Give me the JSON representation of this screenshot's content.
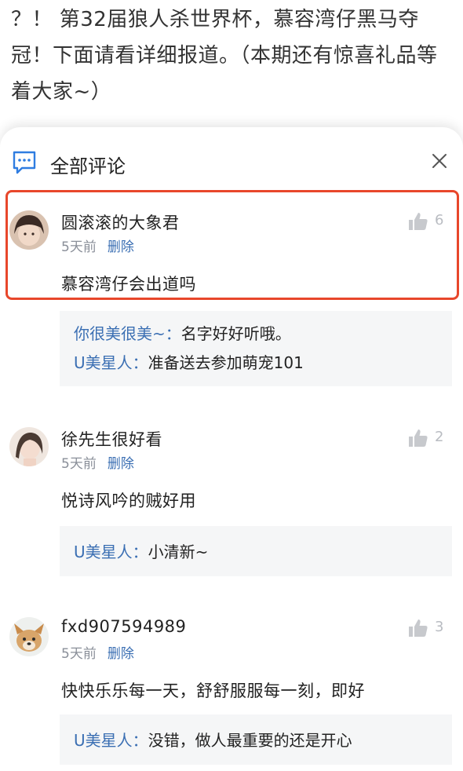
{
  "article": {
    "text": "？！ 第32届狼人杀世界杯，慕容湾仔黑马夺冠！下面请看详细报道。（本期还有惊喜礼品等着大家~）"
  },
  "sheet": {
    "title": "全部评论"
  },
  "comments": [
    {
      "author": "圆滚滚的大象君",
      "time": "5天前",
      "delete_label": "删除",
      "likes": "6",
      "text": "慕容湾仔会出道吗",
      "replies": [
        {
          "nick": "你很美很美~：",
          "text": "名字好好听哦。"
        },
        {
          "nick": "U美星人：",
          "text": "准备送去参加萌宠101"
        }
      ]
    },
    {
      "author": "徐先生很好看",
      "time": "5天前",
      "delete_label": "删除",
      "likes": "2",
      "text": "悦诗风吟的贼好用",
      "replies": [
        {
          "nick": "U美星人：",
          "text": "小清新~"
        }
      ]
    },
    {
      "author": "fxd907594989",
      "time": "5天前",
      "delete_label": "删除",
      "likes": "3",
      "text": "快快乐乐每一天，舒舒服服每一刻，即好",
      "replies": [
        {
          "nick": "U美星人：",
          "text": "没错，做人最重要的还是开心"
        }
      ]
    }
  ],
  "colors": {
    "highlight": "#e8472b",
    "link": "#3b6fb3",
    "meta": "#8a8f99",
    "reply_bg": "#f5f6f7"
  }
}
